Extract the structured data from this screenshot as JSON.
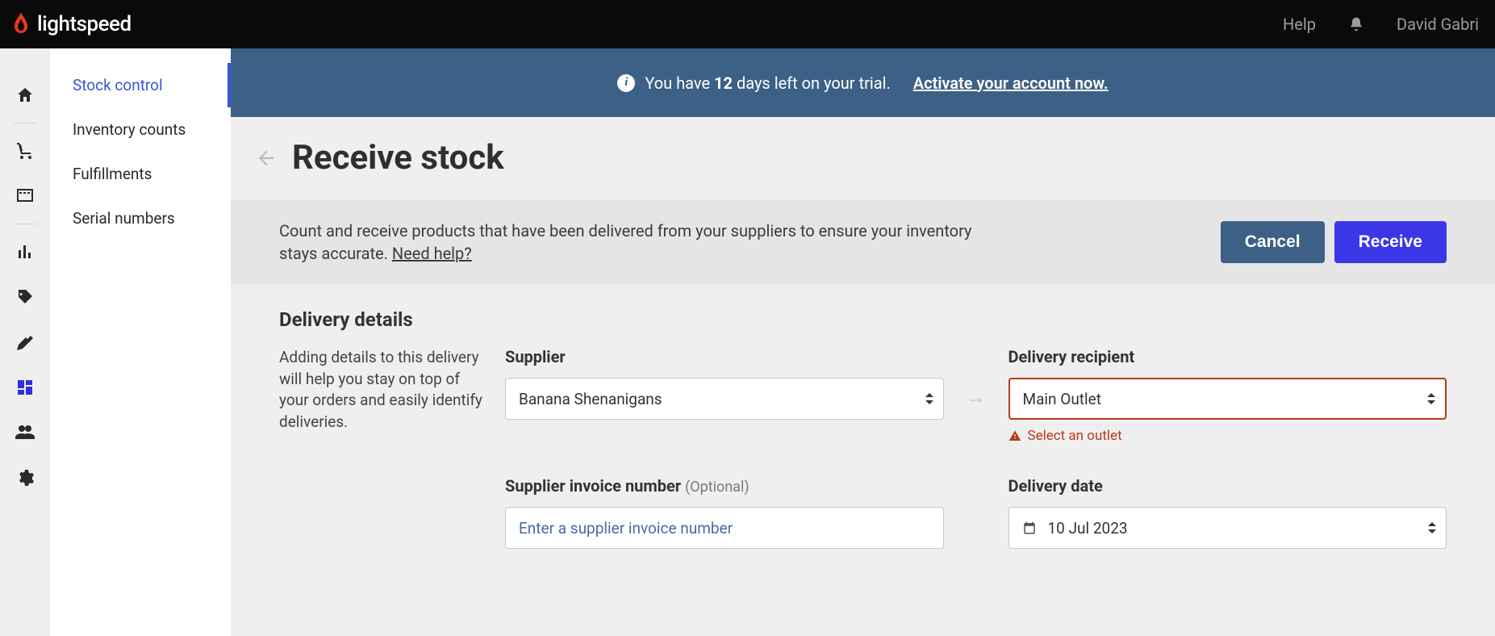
{
  "brand": "lightspeed",
  "top": {
    "help": "Help",
    "user": "David Gabri"
  },
  "sidebar": {
    "items": [
      {
        "label": "Stock control"
      },
      {
        "label": "Inventory counts"
      },
      {
        "label": "Fulfillments"
      },
      {
        "label": "Serial numbers"
      }
    ]
  },
  "banner": {
    "prefix": "You have ",
    "days": "12",
    "suffix": " days left on your trial.",
    "cta": "Activate your account now."
  },
  "page": {
    "title": "Receive stock",
    "desc": "Count and receive products that have been delivered from your suppliers to ensure your inventory stays accurate. ",
    "help_link": "Need help?",
    "cancel": "Cancel",
    "receive": "Receive"
  },
  "delivery": {
    "section_title": "Delivery details",
    "help_text": "Adding details to this delivery will help you stay on top of your orders and easily identify deliveries.",
    "supplier_label": "Supplier",
    "supplier_value": "Banana Shenanigans",
    "recipient_label": "Delivery recipient",
    "recipient_value": "Main Outlet",
    "recipient_error": "Select an outlet",
    "invoice_label": "Supplier invoice number",
    "invoice_optional": "(Optional)",
    "invoice_placeholder": "Enter a supplier invoice number",
    "date_label": "Delivery date",
    "date_value": "10 Jul 2023"
  }
}
